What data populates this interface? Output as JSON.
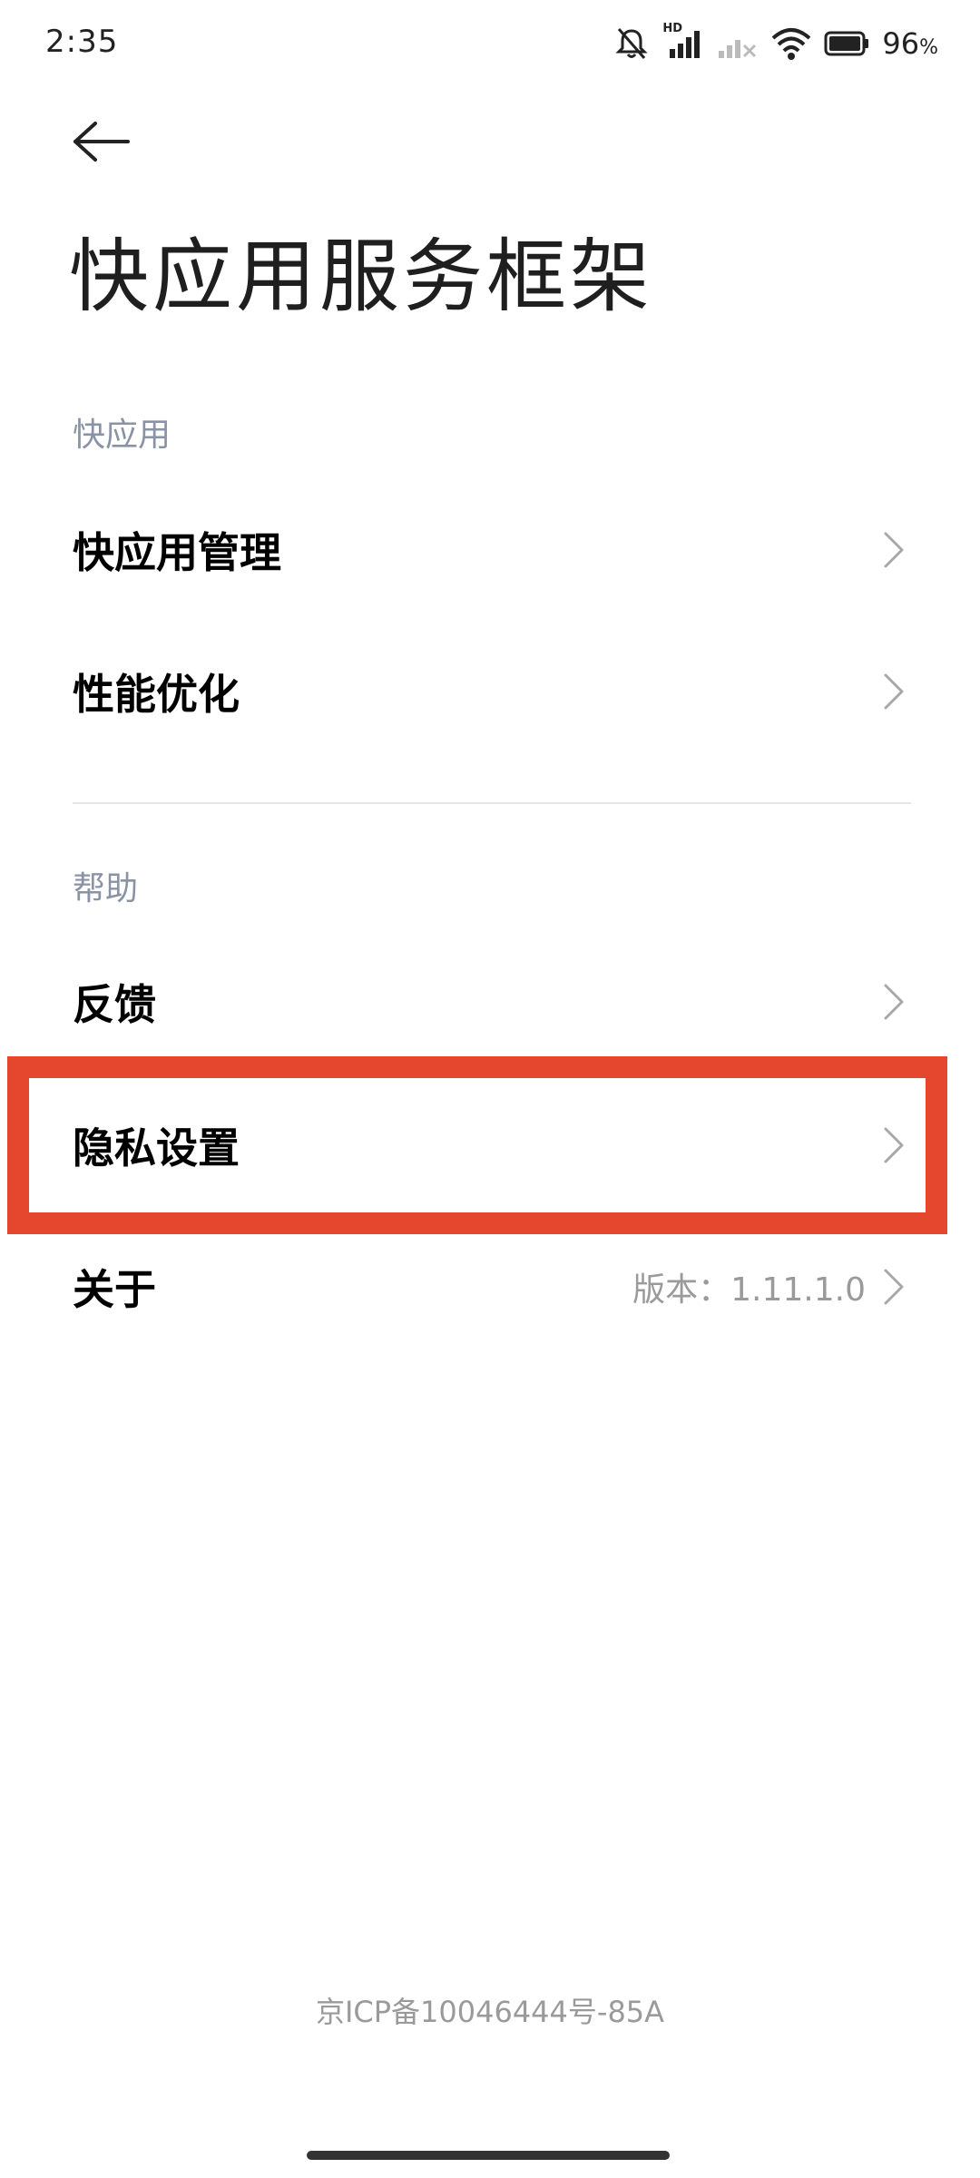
{
  "status_bar": {
    "time": "2:35",
    "network_label": "HD",
    "battery_percent": "96",
    "battery_unit": "%",
    "icons": [
      "mute-icon",
      "hd-signal-icon",
      "signal-no-service-icon",
      "wifi-icon",
      "battery-icon"
    ]
  },
  "header": {
    "back_icon": "arrow-left-icon",
    "title": "快应用服务框架"
  },
  "sections": {
    "quickapp": {
      "header": "快应用",
      "items": [
        {
          "label": "快应用管理",
          "icon": "chevron-right-icon"
        },
        {
          "label": "性能优化",
          "icon": "chevron-right-icon"
        }
      ]
    },
    "help": {
      "header": "帮助",
      "items": [
        {
          "label": "反馈",
          "icon": "chevron-right-icon"
        },
        {
          "label": "隐私设置",
          "icon": "chevron-right-icon",
          "highlighted": true
        },
        {
          "label": "关于",
          "value": "版本：1.11.1.0",
          "icon": "chevron-right-icon"
        }
      ]
    }
  },
  "footer": {
    "icp": "京ICP备10046444号-85A"
  },
  "colors": {
    "highlight": "#e4462e",
    "section_header": "#8a93a6",
    "secondary_text": "#9a9a9a"
  }
}
